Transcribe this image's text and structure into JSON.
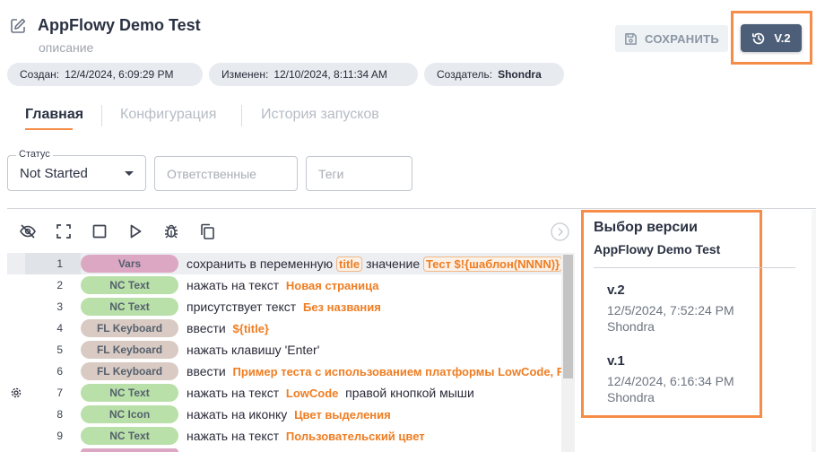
{
  "header": {
    "title": "AppFlowy Demo Test",
    "subtitle": "описание",
    "save_label": "СОХРАНИТЬ",
    "version_label": "V.2"
  },
  "meta": {
    "created_label": "Создан:",
    "created_value": "12/4/2024, 6:09:29 PM",
    "modified_label": "Изменен:",
    "modified_value": "12/10/2024, 8:11:34 AM",
    "author_label": "Создатель:",
    "author_value": "Shondra"
  },
  "tabs": [
    {
      "label": "Главная"
    },
    {
      "label": "Конфигурация"
    },
    {
      "label": "История запусков"
    }
  ],
  "filters": {
    "status_label": "Статус",
    "status_value": "Not Started",
    "assignees_placeholder": "Ответственные",
    "tags_placeholder": "Теги"
  },
  "toolbar": {
    "icons": [
      "eye-off-icon",
      "fullscreen-icon",
      "stop-icon",
      "play-icon",
      "bug-icon",
      "copy-icon",
      "chevron-right-circle-icon"
    ]
  },
  "steps": [
    {
      "num": "1",
      "type": "Vars",
      "t1": "сохранить в переменную",
      "c1": "title",
      "t2": "значение",
      "c2": "Тест $!{шаблон(NNNN)}"
    },
    {
      "num": "2",
      "type": "NC Text",
      "t1": "нажать на текст",
      "o1": "Новая страница"
    },
    {
      "num": "3",
      "type": "NC Text",
      "t1": "присутствует текст",
      "o1": "Без названия"
    },
    {
      "num": "4",
      "type": "FL Keyboard",
      "t1": "ввести",
      "o1": "${title}"
    },
    {
      "num": "5",
      "type": "FL Keyboard",
      "t1": "нажать клавишу 'Enter'"
    },
    {
      "num": "6",
      "type": "FL Keyboard",
      "t1": "ввести",
      "o1": "Пример теста с использованием платформы LowCode, FlaUI"
    },
    {
      "num": "7",
      "type": "NC Text",
      "t1": "нажать на текст",
      "o1": "LowCode",
      "t2": "правой кнопкой мыши"
    },
    {
      "num": "8",
      "type": "NC Icon",
      "t1": "нажать на иконку",
      "o1": "Цвет выделения"
    },
    {
      "num": "9",
      "type": "NC Text",
      "t1": "нажать на текст",
      "o1": "Пользовательский цвет"
    }
  ],
  "version_panel": {
    "title": "Выбор версии",
    "subtitle": "AppFlowy Demo Test",
    "versions": [
      {
        "name": "v.2",
        "date": "12/5/2024, 7:52:24 PM",
        "user": "Shondra"
      },
      {
        "name": "v.1",
        "date": "12/4/2024, 6:16:34 PM",
        "user": "Shondra"
      }
    ]
  },
  "colors": {
    "accent": "#f58c47",
    "version_button": "#4d5e78",
    "vars_pill": "#dba7c3",
    "nc_pill": "#b8e0a8",
    "fl_pill": "#d9cbc3",
    "param_text": "#ef7d22"
  }
}
